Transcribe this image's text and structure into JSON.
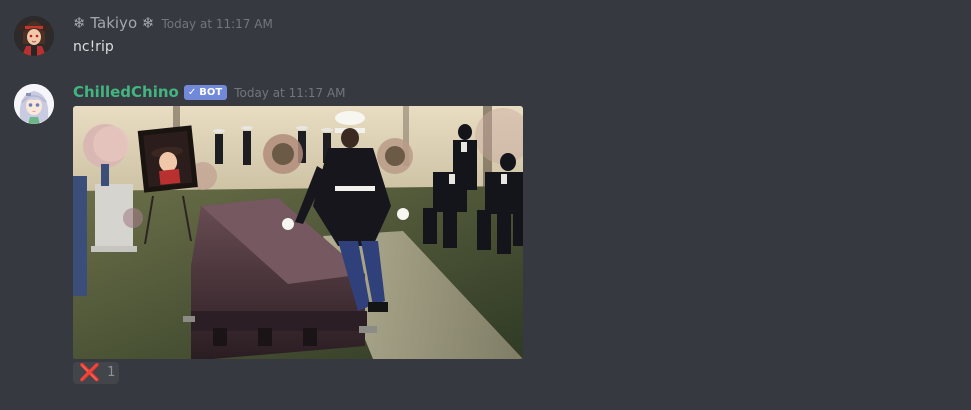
{
  "messages": [
    {
      "username": "❄ Takiyo ❄",
      "timestamp": "Today at 11:17 AM",
      "text": "nc!rip"
    },
    {
      "username": "ChilledChino",
      "bot_tag": "BOT",
      "bot_check": "✓",
      "timestamp": "Today at 11:17 AM",
      "image_icon": "funeral-coffin-scene",
      "reaction": {
        "emoji_icon": "x-mark-icon",
        "emoji": "❌",
        "count": "1"
      }
    }
  ],
  "colors": {
    "background": "#36393f",
    "bot_username": "#43b581",
    "bot_tag": "#7289da",
    "user_name": "#a4a7ab",
    "timestamp": "#72767d",
    "message_text": "#dcddde",
    "reaction_bg": "#42454a"
  }
}
